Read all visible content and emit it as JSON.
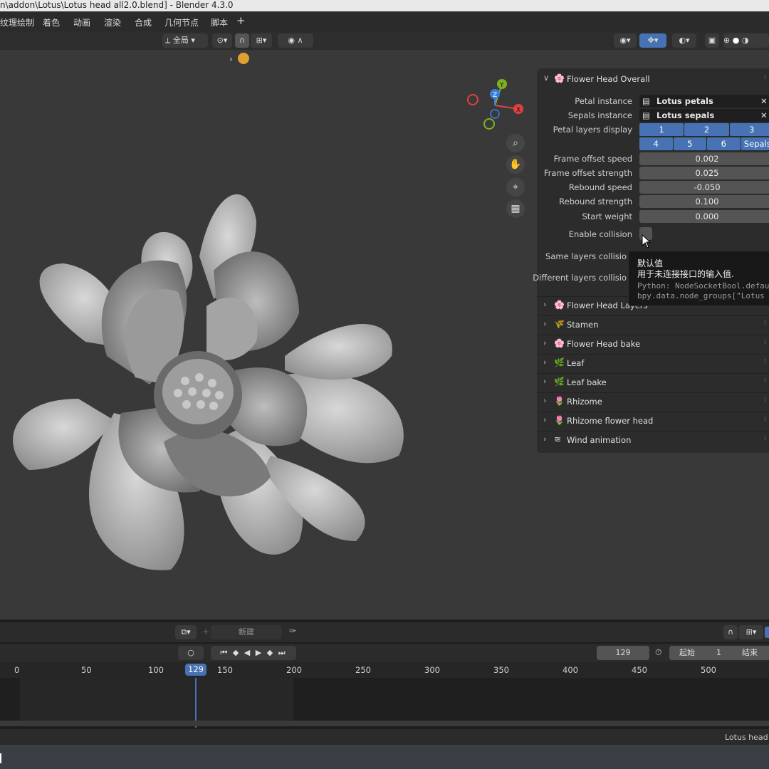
{
  "window": {
    "title": "n\\addon\\Lotus\\Lotus head all2.0.blend] - Blender 4.3.0"
  },
  "menu": {
    "items": [
      "纹理绘制",
      "着色",
      "动画",
      "渲染",
      "合成",
      "几何节点",
      "脚本",
      "+"
    ]
  },
  "header": {
    "transform_orientation": "全局"
  },
  "panel": {
    "title": "Flower Head Overall",
    "rows": [
      {
        "label": "Petal instance",
        "value": "Lotus petals"
      },
      {
        "label": "Sepals instance",
        "value": "Lotus sepals"
      }
    ],
    "layers_label": "Petal layers display",
    "layer_buttons_row1": [
      "1",
      "2",
      "3"
    ],
    "layer_buttons_row2": [
      "4",
      "5",
      "6",
      "Sepals"
    ],
    "fields": [
      {
        "label": "Frame offset speed",
        "value": "0.002"
      },
      {
        "label": "Frame offset strength",
        "value": "0.025"
      },
      {
        "label": "Rebound speed",
        "value": "-0.050"
      },
      {
        "label": "Rebound strength",
        "value": "0.100"
      },
      {
        "label": "Start weight",
        "value": "0.000"
      }
    ],
    "enable_collision_label": "Enable collision",
    "same_layers_label": "Same layers collisio",
    "different_layers_label": "Different layers collisio",
    "sections": [
      {
        "title": "Flower Head Layers",
        "icon": "🌸"
      },
      {
        "title": "Stamen",
        "icon": "🌾"
      },
      {
        "title": "Flower Head bake",
        "icon": "🌸"
      },
      {
        "title": "Leaf",
        "icon": "🌿"
      },
      {
        "title": "Leaf bake",
        "icon": "🌿"
      },
      {
        "title": "Rhizome",
        "icon": "🌷"
      },
      {
        "title": "Rhizome flower head",
        "icon": "🌷"
      },
      {
        "title": "Wind animation",
        "icon": "≋"
      }
    ]
  },
  "tooltip": {
    "line1": "默认值",
    "line2": "用于未连接接口的输入值.",
    "line3": "Python: NodeSocketBool.defau",
    "line4": "bpy.data.node_groups[\"Lotus "
  },
  "gizmo": {
    "x": "X",
    "y": "Y",
    "z": "Z"
  },
  "timeline": {
    "new_label": "新建",
    "current_frame": "129",
    "start_label": "起始",
    "start_value": "1",
    "end_label": "结束",
    "ticks": [
      "0",
      "50",
      "100",
      "150",
      "200",
      "250",
      "300",
      "350",
      "400",
      "450",
      "500"
    ],
    "playhead": "129"
  },
  "status": {
    "right_text": "Lotus head"
  },
  "colors": {
    "accent": "#4772b3",
    "viewport": "#393939",
    "panel": "#2c2c2c"
  }
}
